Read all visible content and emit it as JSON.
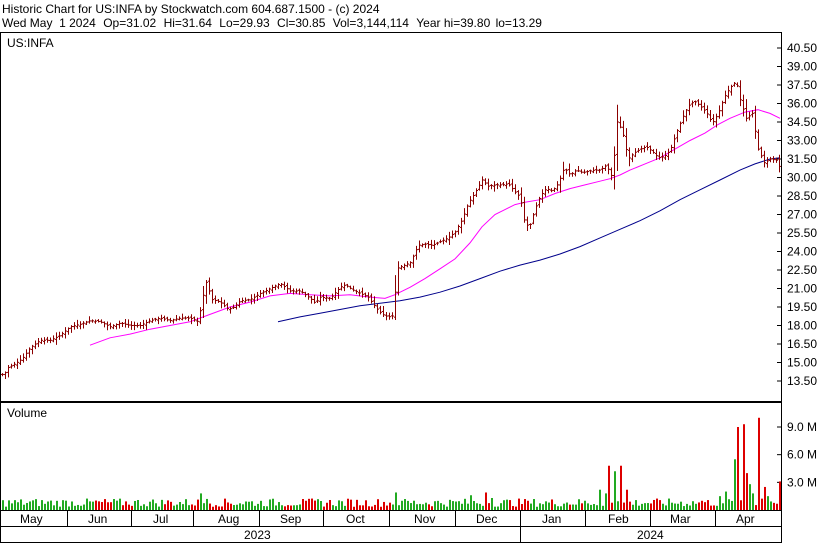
{
  "header": {
    "line1": "Historic Chart for US:INFA by Stockwatch.com 604.687.1500 - (c) 2024",
    "date": "Wed May  1 2024",
    "open": "Op=31.02",
    "high": "Hi=31.64",
    "low": "Lo=29.93",
    "close": "Cl=30.85",
    "volume": "Vol=3,144,114",
    "year_high": "Year hi=39.80",
    "year_low": "lo=13.29"
  },
  "colors": {
    "bar": "#8b0000",
    "ma_short": "#ff00ff",
    "ma_long": "#00008b",
    "vol_up": "#22aa22",
    "vol_down": "#dd0000",
    "frame": "#000000"
  },
  "chart_data": [
    {
      "type": "ohlc",
      "title": "US:INFA",
      "ylim": [
        12.0,
        41.5
      ],
      "y_ticks": [
        "40.50",
        "39.00",
        "37.50",
        "36.00",
        "34.50",
        "33.00",
        "31.50",
        "30.00",
        "28.50",
        "27.00",
        "25.50",
        "24.00",
        "22.50",
        "21.00",
        "19.50",
        "18.00",
        "16.50",
        "15.00",
        "13.50"
      ],
      "year_high": 39.8,
      "year_low": 13.29,
      "x_months": [
        "May",
        "Jun",
        "Jul",
        "Aug",
        "Sep",
        "Oct",
        "Nov",
        "Dec",
        "Jan",
        "Feb",
        "Mar",
        "Apr"
      ],
      "x_years": [
        "2023",
        "2024"
      ],
      "price_path": [
        [
          0,
          14.3
        ],
        [
          3,
          13.9
        ],
        [
          8,
          14.6
        ],
        [
          15,
          14.9
        ],
        [
          22,
          15.3
        ],
        [
          30,
          16.2
        ],
        [
          40,
          16.8
        ],
        [
          50,
          16.8
        ],
        [
          60,
          17.2
        ],
        [
          70,
          17.9
        ],
        [
          80,
          18.1
        ],
        [
          90,
          18.4
        ],
        [
          100,
          18.3
        ],
        [
          110,
          17.9
        ],
        [
          120,
          18.2
        ],
        [
          130,
          18.0
        ],
        [
          140,
          18.0
        ],
        [
          150,
          18.4
        ],
        [
          160,
          18.6
        ],
        [
          170,
          18.4
        ],
        [
          180,
          18.6
        ],
        [
          190,
          18.6
        ],
        [
          198,
          18.3
        ],
        [
          202,
          20.1
        ],
        [
          206,
          21.5
        ],
        [
          212,
          20.1
        ],
        [
          220,
          19.9
        ],
        [
          228,
          19.3
        ],
        [
          234,
          19.5
        ],
        [
          240,
          20.0
        ],
        [
          250,
          20.1
        ],
        [
          260,
          20.6
        ],
        [
          270,
          21.0
        ],
        [
          280,
          21.4
        ],
        [
          290,
          20.8
        ],
        [
          300,
          20.8
        ],
        [
          310,
          20.2
        ],
        [
          315,
          19.8
        ],
        [
          320,
          20.3
        ],
        [
          330,
          20.2
        ],
        [
          340,
          21.1
        ],
        [
          345,
          21.3
        ],
        [
          352,
          20.9
        ],
        [
          360,
          20.6
        ],
        [
          368,
          20.3
        ],
        [
          375,
          19.5
        ],
        [
          382,
          18.9
        ],
        [
          388,
          18.7
        ],
        [
          394,
          18.8
        ],
        [
          396,
          22.6
        ],
        [
          402,
          22.8
        ],
        [
          410,
          23.1
        ],
        [
          418,
          24.5
        ],
        [
          425,
          24.6
        ],
        [
          432,
          24.5
        ],
        [
          440,
          24.8
        ],
        [
          448,
          25.1
        ],
        [
          455,
          25.6
        ],
        [
          462,
          26.6
        ],
        [
          468,
          27.9
        ],
        [
          475,
          28.8
        ],
        [
          482,
          29.8
        ],
        [
          488,
          29.3
        ],
        [
          495,
          29.4
        ],
        [
          502,
          29.4
        ],
        [
          508,
          29.5
        ],
        [
          514,
          28.9
        ],
        [
          520,
          28.4
        ],
        [
          525,
          26.1
        ],
        [
          530,
          26.2
        ],
        [
          535,
          27.5
        ],
        [
          540,
          28.5
        ],
        [
          546,
          29.1
        ],
        [
          552,
          28.9
        ],
        [
          558,
          29.5
        ],
        [
          564,
          30.8
        ],
        [
          570,
          30.2
        ],
        [
          576,
          30.6
        ],
        [
          582,
          30.4
        ],
        [
          588,
          30.5
        ],
        [
          594,
          30.6
        ],
        [
          600,
          30.6
        ],
        [
          606,
          31.0
        ],
        [
          612,
          30.0
        ],
        [
          617,
          34.5
        ],
        [
          622,
          33.8
        ],
        [
          628,
          31.5
        ],
        [
          634,
          32.0
        ],
        [
          640,
          32.3
        ],
        [
          646,
          32.5
        ],
        [
          652,
          32.1
        ],
        [
          658,
          31.6
        ],
        [
          664,
          31.7
        ],
        [
          670,
          32.2
        ],
        [
          676,
          33.6
        ],
        [
          682,
          34.8
        ],
        [
          688,
          35.8
        ],
        [
          694,
          36.2
        ],
        [
          700,
          35.8
        ],
        [
          706,
          35.3
        ],
        [
          712,
          34.4
        ],
        [
          718,
          35.2
        ],
        [
          724,
          36.5
        ],
        [
          730,
          37.3
        ],
        [
          736,
          37.8
        ],
        [
          740,
          36.3
        ],
        [
          746,
          34.8
        ],
        [
          752,
          35.2
        ],
        [
          758,
          32.3
        ],
        [
          764,
          31.2
        ],
        [
          770,
          31.5
        ],
        [
          776,
          31.4
        ],
        [
          779,
          30.9
        ]
      ],
      "ma_short_path": [
        [
          90,
          16.4
        ],
        [
          110,
          17.0
        ],
        [
          130,
          17.3
        ],
        [
          150,
          17.7
        ],
        [
          170,
          18.0
        ],
        [
          190,
          18.3
        ],
        [
          210,
          18.9
        ],
        [
          230,
          19.5
        ],
        [
          250,
          19.9
        ],
        [
          270,
          20.4
        ],
        [
          290,
          20.6
        ],
        [
          310,
          20.5
        ],
        [
          330,
          20.4
        ],
        [
          350,
          20.5
        ],
        [
          370,
          20.3
        ],
        [
          385,
          20.2
        ],
        [
          395,
          20.5
        ],
        [
          410,
          21.1
        ],
        [
          425,
          21.8
        ],
        [
          440,
          22.6
        ],
        [
          455,
          23.4
        ],
        [
          470,
          24.7
        ],
        [
          482,
          26.0
        ],
        [
          495,
          27.0
        ],
        [
          505,
          27.4
        ],
        [
          515,
          27.8
        ],
        [
          525,
          28.0
        ],
        [
          540,
          28.2
        ],
        [
          555,
          28.7
        ],
        [
          570,
          29.1
        ],
        [
          585,
          29.4
        ],
        [
          600,
          29.7
        ],
        [
          610,
          29.9
        ],
        [
          620,
          30.2
        ],
        [
          630,
          30.6
        ],
        [
          645,
          31.1
        ],
        [
          660,
          31.6
        ],
        [
          675,
          32.3
        ],
        [
          690,
          33.0
        ],
        [
          705,
          33.6
        ],
        [
          718,
          34.3
        ],
        [
          730,
          34.8
        ],
        [
          745,
          35.3
        ],
        [
          758,
          35.5
        ],
        [
          770,
          35.2
        ],
        [
          780,
          34.8
        ]
      ],
      "ma_long_path": [
        [
          278,
          18.3
        ],
        [
          300,
          18.7
        ],
        [
          320,
          19.0
        ],
        [
          340,
          19.3
        ],
        [
          360,
          19.6
        ],
        [
          380,
          19.8
        ],
        [
          400,
          20.0
        ],
        [
          420,
          20.3
        ],
        [
          440,
          20.7
        ],
        [
          460,
          21.2
        ],
        [
          480,
          21.8
        ],
        [
          500,
          22.4
        ],
        [
          520,
          22.9
        ],
        [
          540,
          23.3
        ],
        [
          560,
          23.8
        ],
        [
          580,
          24.4
        ],
        [
          600,
          25.1
        ],
        [
          620,
          25.8
        ],
        [
          640,
          26.5
        ],
        [
          660,
          27.3
        ],
        [
          680,
          28.2
        ],
        [
          700,
          29.0
        ],
        [
          720,
          29.8
        ],
        [
          740,
          30.6
        ],
        [
          755,
          31.1
        ],
        [
          770,
          31.5
        ],
        [
          780,
          31.6
        ]
      ]
    },
    {
      "type": "bar",
      "title": "Volume",
      "ylim": [
        0,
        11.0
      ],
      "y_ticks": [
        "9.0 M",
        "6.0 M",
        "3.0 M"
      ],
      "units": "millions of shares",
      "spikes": [
        [
          200,
          1.8
        ],
        [
          206,
          1.2
        ],
        [
          305,
          1.0
        ],
        [
          395,
          1.9
        ],
        [
          400,
          1.0
        ],
        [
          470,
          1.6
        ],
        [
          484,
          1.9
        ],
        [
          490,
          1.3
        ],
        [
          528,
          1.0
        ],
        [
          598,
          2.2
        ],
        [
          604,
          1.8
        ],
        [
          609,
          4.8
        ],
        [
          614,
          4.2
        ],
        [
          619,
          4.8
        ],
        [
          627,
          2.2
        ],
        [
          700,
          1.0
        ],
        [
          720,
          1.5
        ],
        [
          726,
          2.0
        ],
        [
          733,
          5.5
        ],
        [
          738,
          9.0
        ],
        [
          742,
          9.3
        ],
        [
          746,
          4.0
        ],
        [
          750,
          2.8
        ],
        [
          752,
          1.8
        ],
        [
          757,
          10.0
        ],
        [
          763,
          2.5
        ],
        [
          768,
          1.5
        ],
        [
          779,
          3.1
        ]
      ]
    }
  ]
}
